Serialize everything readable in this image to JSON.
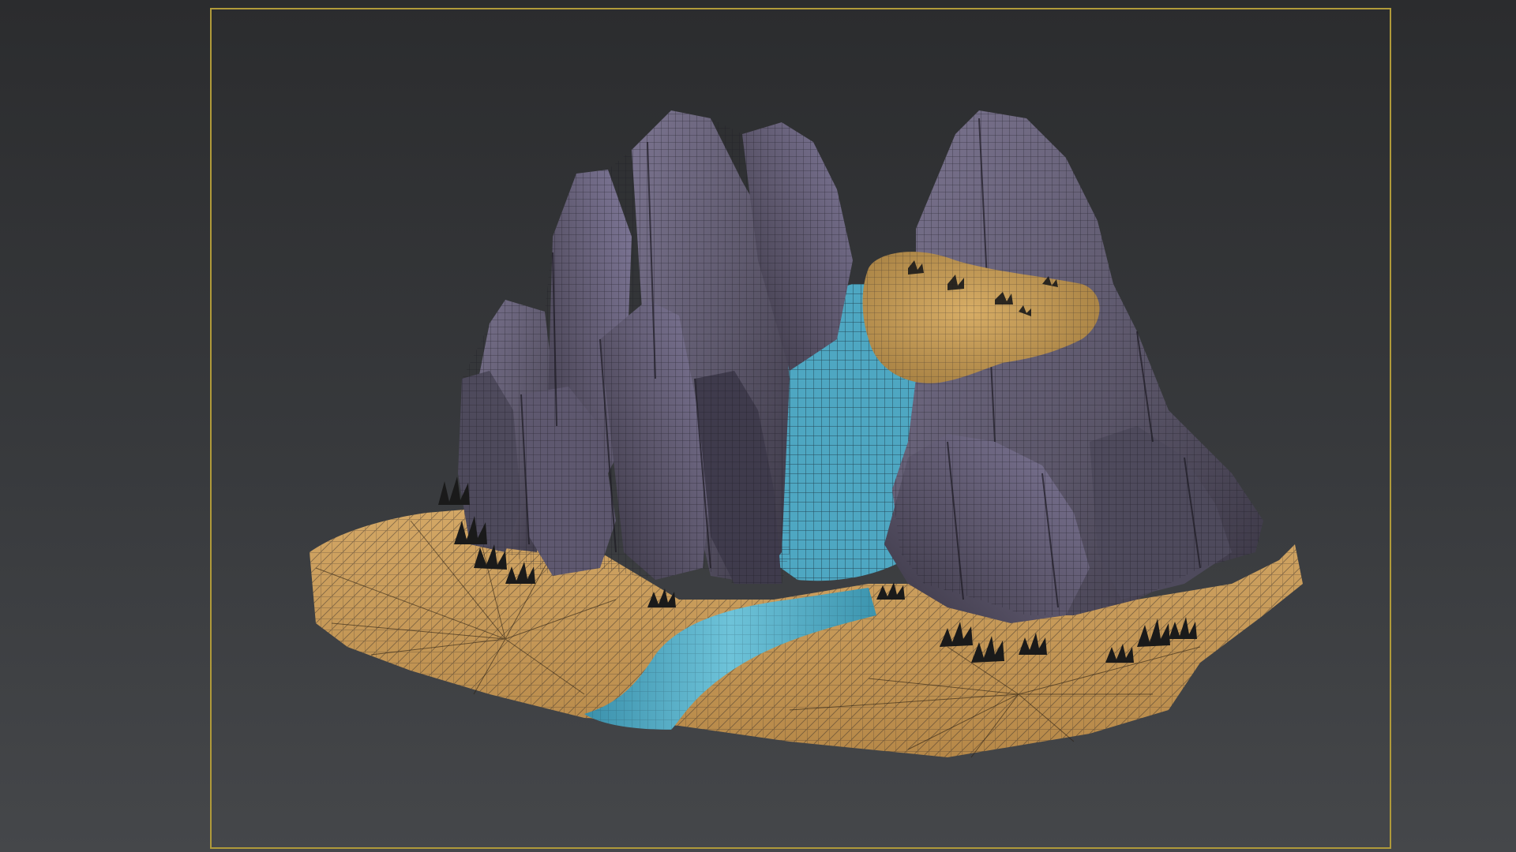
{
  "viewport": {
    "background_top": "#2b2c2e",
    "background_bottom": "#45474a",
    "safe_frame_color": "#b09a3a"
  },
  "scene": {
    "rock_color": "#5a5568",
    "rock_shadow_color": "#3a3644",
    "rock_light_color": "#7b7490",
    "ground_color": "#c79c58",
    "ground_dark_color": "#9b7640",
    "water_color": "#4aa4c0",
    "water_light_color": "#6ec3d9",
    "wire_color": "#1c1a22",
    "plant_color": "#1a1a1a"
  }
}
